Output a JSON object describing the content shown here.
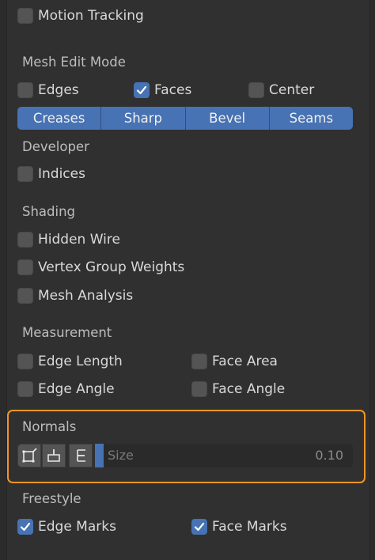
{
  "motion_tracking": {
    "label": "Motion Tracking",
    "checked": false
  },
  "mesh_edit_mode": {
    "title": "Mesh Edit Mode",
    "edges": {
      "label": "Edges",
      "checked": false
    },
    "faces": {
      "label": "Faces",
      "checked": true
    },
    "center": {
      "label": "Center",
      "checked": false
    },
    "toggles": [
      "Creases",
      "Sharp",
      "Bevel",
      "Seams"
    ]
  },
  "developer": {
    "title": "Developer",
    "indices": {
      "label": "Indices",
      "checked": false
    }
  },
  "shading": {
    "title": "Shading",
    "hidden_wire": {
      "label": "Hidden Wire",
      "checked": false
    },
    "vertex_group_weights": {
      "label": "Vertex Group Weights",
      "checked": false
    },
    "mesh_analysis": {
      "label": "Mesh Analysis",
      "checked": false
    }
  },
  "measurement": {
    "title": "Measurement",
    "edge_length": {
      "label": "Edge Length",
      "checked": false
    },
    "face_area": {
      "label": "Face Area",
      "checked": false
    },
    "edge_angle": {
      "label": "Edge Angle",
      "checked": false
    },
    "face_angle": {
      "label": "Face Angle",
      "checked": false
    }
  },
  "normals": {
    "title": "Normals",
    "tools": [
      "vertex-normals-icon",
      "split-normals-icon",
      "face-normals-icon"
    ],
    "size_label": "Size",
    "size_value": "0.10"
  },
  "freestyle": {
    "title": "Freestyle",
    "edge_marks": {
      "label": "Edge Marks",
      "checked": true
    },
    "face_marks": {
      "label": "Face Marks",
      "checked": true
    }
  },
  "colors": {
    "accent": "#4772b3",
    "highlight": "#f0952a",
    "panel": "#303030"
  }
}
